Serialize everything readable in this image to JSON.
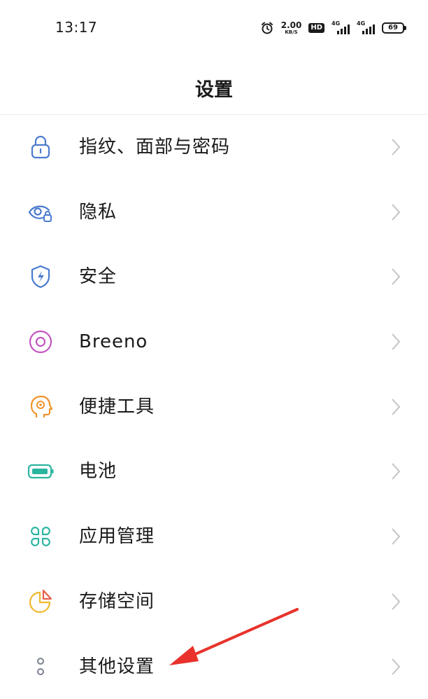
{
  "status_bar": {
    "time": "13:17",
    "net_speed_value": "2.00",
    "net_speed_unit": "KB/S",
    "hd_label": "HD",
    "sim1_network": "4G",
    "sim2_network": "4G",
    "battery_level": "69",
    "icons": [
      "alarm-icon",
      "hd-icon",
      "signal-icon",
      "signal-icon",
      "battery-icon"
    ]
  },
  "header": {
    "title": "设置"
  },
  "settings": {
    "items": [
      {
        "label": "指纹、面部与密码",
        "icon": "lock-icon",
        "color": "#4a7bd0"
      },
      {
        "label": "隐私",
        "icon": "eye-lock-icon",
        "color": "#4a7bd0"
      },
      {
        "label": "安全",
        "icon": "shield-icon",
        "color": "#4a7bd0"
      },
      {
        "label": "Breeno",
        "icon": "breeno-icon",
        "color": "#c255c0"
      },
      {
        "label": "便捷工具",
        "icon": "head-icon",
        "color": "#f0932b"
      },
      {
        "label": "电池",
        "icon": "battery-icon",
        "color": "#2bb5a0"
      },
      {
        "label": "应用管理",
        "icon": "apps-icon",
        "color": "#2bb5a0"
      },
      {
        "label": "存储空间",
        "icon": "pie-icon",
        "color": "#f0b92b"
      },
      {
        "label": "其他设置",
        "icon": "more-icon",
        "color": "#7a8190"
      }
    ]
  },
  "colors": {
    "chevron": "#c4c4c4",
    "annotation_arrow": "#e8322b"
  }
}
